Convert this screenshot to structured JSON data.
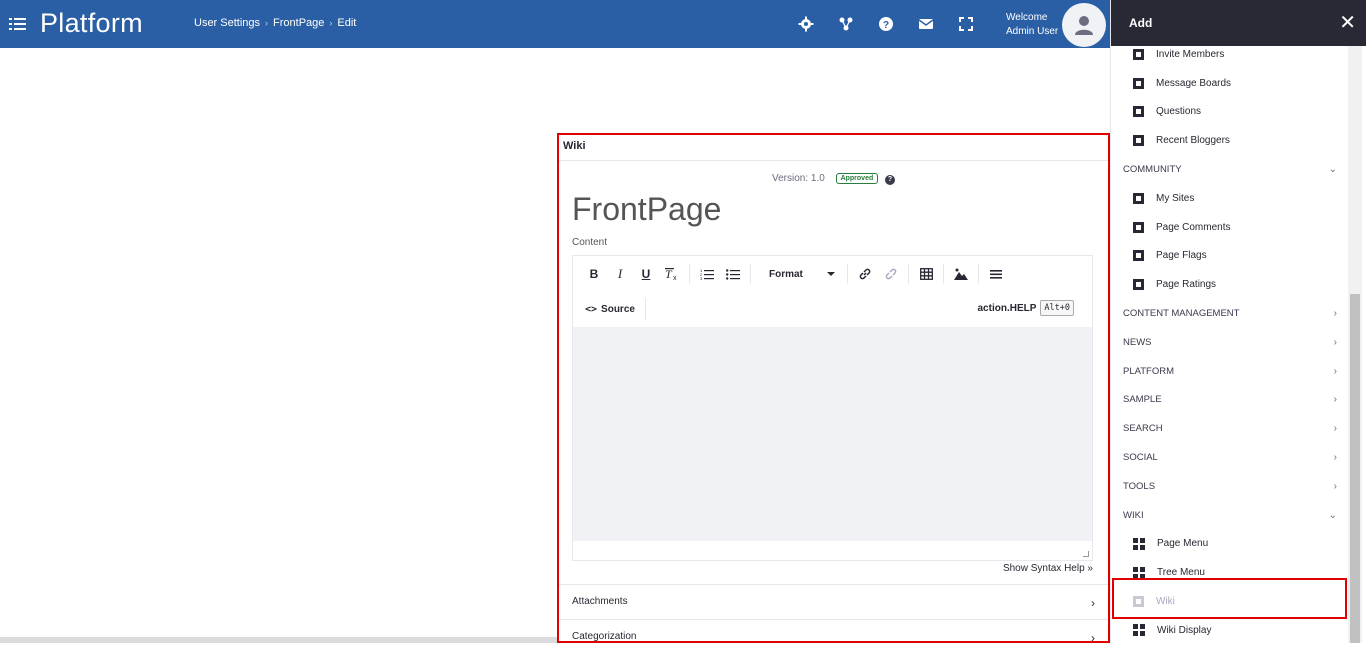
{
  "header": {
    "app_title": "Platform",
    "breadcrumb": [
      "User Settings",
      "FrontPage",
      "Edit"
    ],
    "welcome": "Welcome",
    "user": "Admin User",
    "icons": [
      "gear-icon",
      "share-icon",
      "help-icon",
      "mail-icon",
      "fullscreen-icon"
    ]
  },
  "portlet": {
    "title": "Wiki",
    "version": "Version: 1.0",
    "status": "Approved",
    "page_title": "FrontPage",
    "content_label": "Content",
    "toolbar": {
      "bold": "B",
      "italic": "I",
      "underline": "U",
      "format": "Format",
      "source": "Source",
      "help": "action.HELP",
      "help_key": "Alt+0"
    },
    "syntax_help": "Show Syntax Help »",
    "panels": [
      "Attachments",
      "Categorization"
    ]
  },
  "sidebar": {
    "title": "Add",
    "rows": [
      {
        "type": "item",
        "label": "Invite Members",
        "icon": "square"
      },
      {
        "type": "item",
        "label": "Message Boards",
        "icon": "square"
      },
      {
        "type": "item",
        "label": "Questions",
        "icon": "square"
      },
      {
        "type": "item",
        "label": "Recent Bloggers",
        "icon": "square"
      },
      {
        "type": "cat",
        "label": "COMMUNITY",
        "open": true
      },
      {
        "type": "item",
        "label": "My Sites",
        "icon": "square"
      },
      {
        "type": "item",
        "label": "Page Comments",
        "icon": "square"
      },
      {
        "type": "item",
        "label": "Page Flags",
        "icon": "square"
      },
      {
        "type": "item",
        "label": "Page Ratings",
        "icon": "square"
      },
      {
        "type": "cat",
        "label": "CONTENT MANAGEMENT",
        "open": false
      },
      {
        "type": "cat",
        "label": "NEWS",
        "open": false
      },
      {
        "type": "cat",
        "label": "PLATFORM",
        "open": false
      },
      {
        "type": "cat",
        "label": "SAMPLE",
        "open": false
      },
      {
        "type": "cat",
        "label": "SEARCH",
        "open": false
      },
      {
        "type": "cat",
        "label": "SOCIAL",
        "open": false
      },
      {
        "type": "cat",
        "label": "TOOLS",
        "open": false
      },
      {
        "type": "cat",
        "label": "WIKI",
        "open": true
      },
      {
        "type": "item",
        "label": "Page Menu",
        "icon": "grid"
      },
      {
        "type": "item",
        "label": "Tree Menu",
        "icon": "grid"
      },
      {
        "type": "item",
        "label": "Wiki",
        "icon": "square",
        "disabled": true
      },
      {
        "type": "item",
        "label": "Wiki Display",
        "icon": "grid"
      }
    ]
  }
}
